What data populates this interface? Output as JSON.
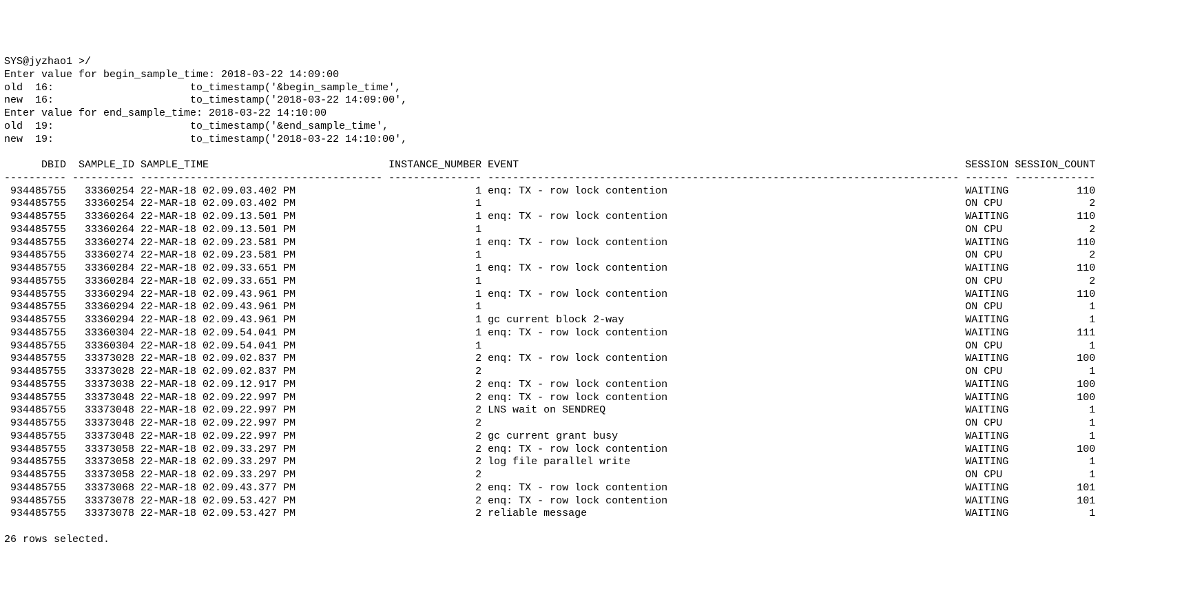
{
  "chart_data": {
    "type": "table",
    "columns": [
      "DBID",
      "SAMPLE_ID",
      "SAMPLE_TIME",
      "INSTANCE_NUMBER",
      "EVENT",
      "SESSION",
      "SESSION_COUNT"
    ],
    "rows": [
      [
        "934485755",
        "33360254",
        "22-MAR-18 02.09.03.402 PM",
        "1",
        "enq: TX - row lock contention",
        "WAITING",
        "110"
      ],
      [
        "934485755",
        "33360254",
        "22-MAR-18 02.09.03.402 PM",
        "1",
        "",
        "ON CPU",
        "2"
      ],
      [
        "934485755",
        "33360264",
        "22-MAR-18 02.09.13.501 PM",
        "1",
        "enq: TX - row lock contention",
        "WAITING",
        "110"
      ],
      [
        "934485755",
        "33360264",
        "22-MAR-18 02.09.13.501 PM",
        "1",
        "",
        "ON CPU",
        "2"
      ],
      [
        "934485755",
        "33360274",
        "22-MAR-18 02.09.23.581 PM",
        "1",
        "enq: TX - row lock contention",
        "WAITING",
        "110"
      ],
      [
        "934485755",
        "33360274",
        "22-MAR-18 02.09.23.581 PM",
        "1",
        "",
        "ON CPU",
        "2"
      ],
      [
        "934485755",
        "33360284",
        "22-MAR-18 02.09.33.651 PM",
        "1",
        "enq: TX - row lock contention",
        "WAITING",
        "110"
      ],
      [
        "934485755",
        "33360284",
        "22-MAR-18 02.09.33.651 PM",
        "1",
        "",
        "ON CPU",
        "2"
      ],
      [
        "934485755",
        "33360294",
        "22-MAR-18 02.09.43.961 PM",
        "1",
        "enq: TX - row lock contention",
        "WAITING",
        "110"
      ],
      [
        "934485755",
        "33360294",
        "22-MAR-18 02.09.43.961 PM",
        "1",
        "",
        "ON CPU",
        "1"
      ],
      [
        "934485755",
        "33360294",
        "22-MAR-18 02.09.43.961 PM",
        "1",
        "gc current block 2-way",
        "WAITING",
        "1"
      ],
      [
        "934485755",
        "33360304",
        "22-MAR-18 02.09.54.041 PM",
        "1",
        "enq: TX - row lock contention",
        "WAITING",
        "111"
      ],
      [
        "934485755",
        "33360304",
        "22-MAR-18 02.09.54.041 PM",
        "1",
        "",
        "ON CPU",
        "1"
      ],
      [
        "934485755",
        "33373028",
        "22-MAR-18 02.09.02.837 PM",
        "2",
        "enq: TX - row lock contention",
        "WAITING",
        "100"
      ],
      [
        "934485755",
        "33373028",
        "22-MAR-18 02.09.02.837 PM",
        "2",
        "",
        "ON CPU",
        "1"
      ],
      [
        "934485755",
        "33373038",
        "22-MAR-18 02.09.12.917 PM",
        "2",
        "enq: TX - row lock contention",
        "WAITING",
        "100"
      ],
      [
        "934485755",
        "33373048",
        "22-MAR-18 02.09.22.997 PM",
        "2",
        "enq: TX - row lock contention",
        "WAITING",
        "100"
      ],
      [
        "934485755",
        "33373048",
        "22-MAR-18 02.09.22.997 PM",
        "2",
        "LNS wait on SENDREQ",
        "WAITING",
        "1"
      ],
      [
        "934485755",
        "33373048",
        "22-MAR-18 02.09.22.997 PM",
        "2",
        "",
        "ON CPU",
        "1"
      ],
      [
        "934485755",
        "33373048",
        "22-MAR-18 02.09.22.997 PM",
        "2",
        "gc current grant busy",
        "WAITING",
        "1"
      ],
      [
        "934485755",
        "33373058",
        "22-MAR-18 02.09.33.297 PM",
        "2",
        "enq: TX - row lock contention",
        "WAITING",
        "100"
      ],
      [
        "934485755",
        "33373058",
        "22-MAR-18 02.09.33.297 PM",
        "2",
        "log file parallel write",
        "WAITING",
        "1"
      ],
      [
        "934485755",
        "33373058",
        "22-MAR-18 02.09.33.297 PM",
        "2",
        "",
        "ON CPU",
        "1"
      ],
      [
        "934485755",
        "33373068",
        "22-MAR-18 02.09.43.377 PM",
        "2",
        "enq: TX - row lock contention",
        "WAITING",
        "101"
      ],
      [
        "934485755",
        "33373078",
        "22-MAR-18 02.09.53.427 PM",
        "2",
        "enq: TX - row lock contention",
        "WAITING",
        "101"
      ],
      [
        "934485755",
        "33373078",
        "22-MAR-18 02.09.53.427 PM",
        "2",
        "reliable message",
        "WAITING",
        "1"
      ]
    ]
  },
  "header": {
    "prompt": "SYS@jyzhao1 >/",
    "begin_prompt": "Enter value for begin_sample_time: 2018-03-22 14:09:00",
    "old16": "old  16:                      to_timestamp('&begin_sample_time',",
    "new16": "new  16:                      to_timestamp('2018-03-22 14:09:00',",
    "end_prompt": "Enter value for end_sample_time: 2018-03-22 14:10:00",
    "old19": "old  19:                      to_timestamp('&end_sample_time',",
    "new19": "new  19:                      to_timestamp('2018-03-22 14:10:00',"
  },
  "cols": {
    "dbid_w": 10,
    "sample_id_w": 10,
    "sample_time_w": 39,
    "instance_w": 15,
    "event_w": 76,
    "session_w": 7,
    "count_w": 13
  },
  "footer": {
    "rows_selected": "26 rows selected."
  }
}
